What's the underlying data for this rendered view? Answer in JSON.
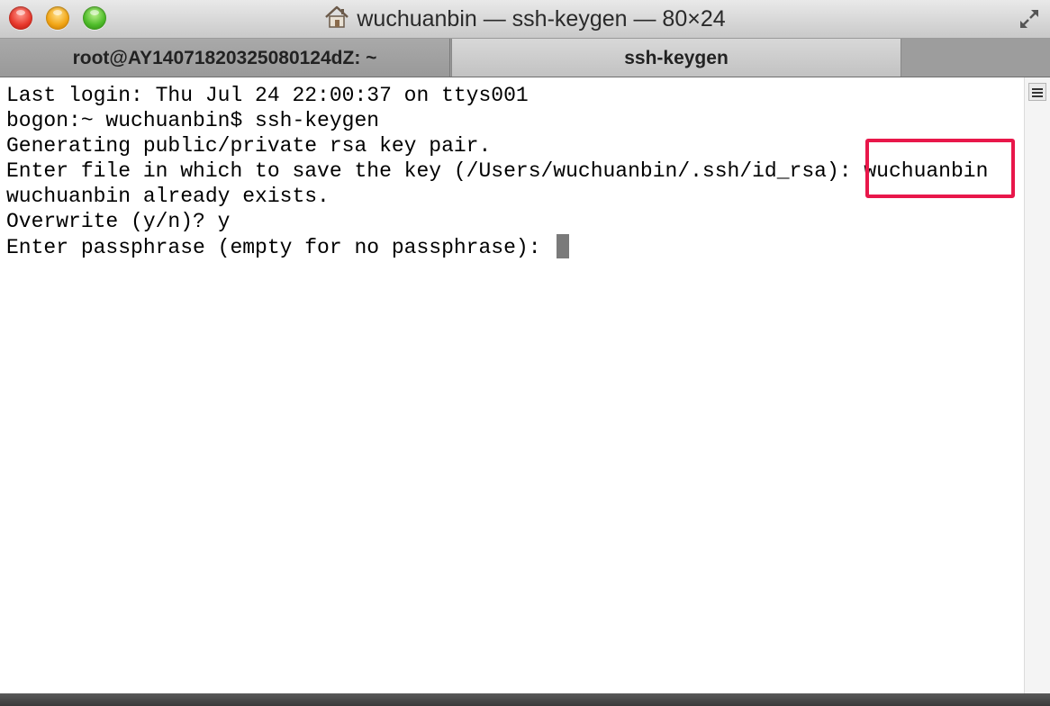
{
  "window": {
    "title": "wuchuanbin — ssh-keygen — 80×24"
  },
  "tabs": [
    {
      "label": "root@AY14071820325080124dZ: ~",
      "active": false
    },
    {
      "label": "ssh-keygen",
      "active": true
    }
  ],
  "terminal": {
    "lines": [
      "Last login: Thu Jul 24 22:00:37 on ttys001",
      "bogon:~ wuchuanbin$ ssh-keygen",
      "Generating public/private rsa key pair.",
      "Enter file in which to save the key (/Users/wuchuanbin/.ssh/id_rsa): wuchuanbin",
      "wuchuanbin already exists.",
      "Overwrite (y/n)? y",
      "Enter passphrase (empty for no passphrase): "
    ]
  },
  "icons": {
    "home": "home-icon",
    "fullscreen": "fullscreen-icon",
    "scroll": "scroll-menu-icon"
  },
  "colors": {
    "highlight": "#e8174a",
    "cursor": "#7a7a7a"
  }
}
